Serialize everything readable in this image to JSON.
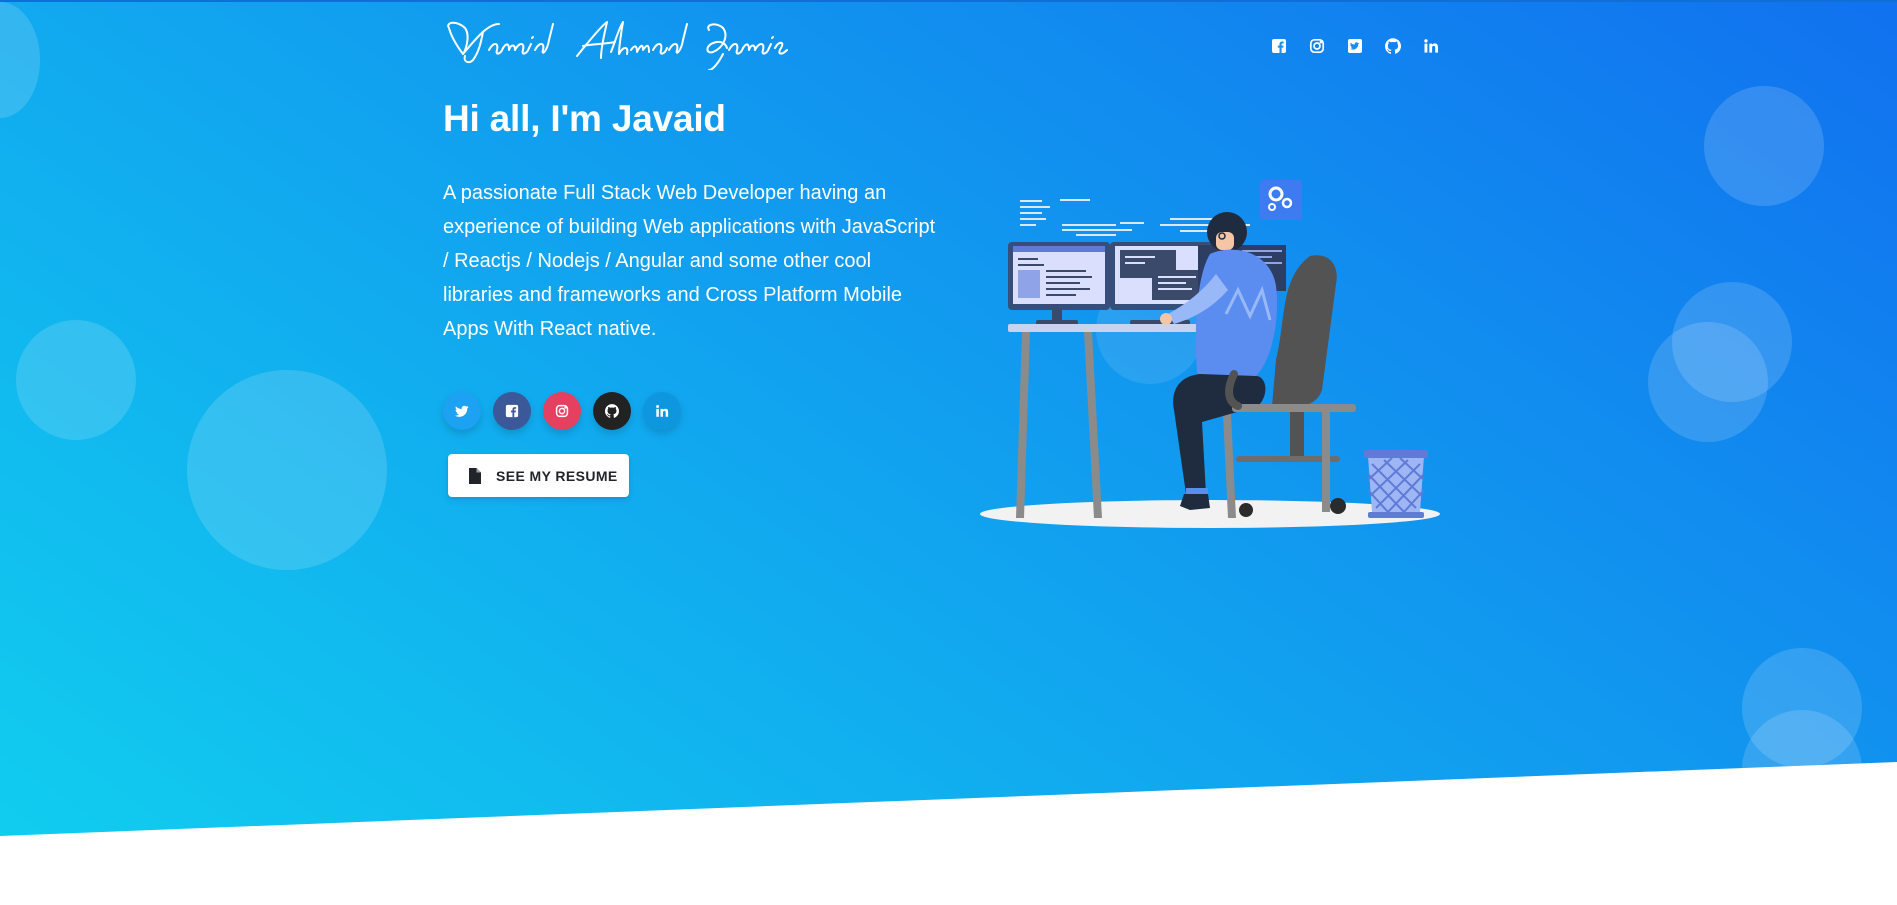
{
  "nav": {
    "brand_signature": "Javaid Ahmad Ganaie",
    "social_icons": [
      "facebook-square-icon",
      "instagram-icon",
      "twitter-square-icon",
      "github-icon",
      "linkedin-icon"
    ]
  },
  "hero": {
    "title": "Hi all, I'm Javaid",
    "description": "A passionate Full Stack Web Developer having an experience of building Web applications with JavaScript / Reactjs / Nodejs / Angular and some other cool libraries and frameworks and Cross Platform Mobile Apps With React native.",
    "social_buttons": [
      {
        "icon": "twitter-icon",
        "color": "#1da1f2"
      },
      {
        "icon": "facebook-square-icon",
        "color": "#3b5998"
      },
      {
        "icon": "instagram-icon",
        "color": "#e4405f"
      },
      {
        "icon": "github-icon",
        "color": "#222222"
      },
      {
        "icon": "linkedin-icon",
        "color": "#0e96df"
      }
    ],
    "resume_button_label": "SEE MY RESUME"
  },
  "colors": {
    "gradient_start": "#11cdef",
    "gradient_end": "#1171ef"
  }
}
